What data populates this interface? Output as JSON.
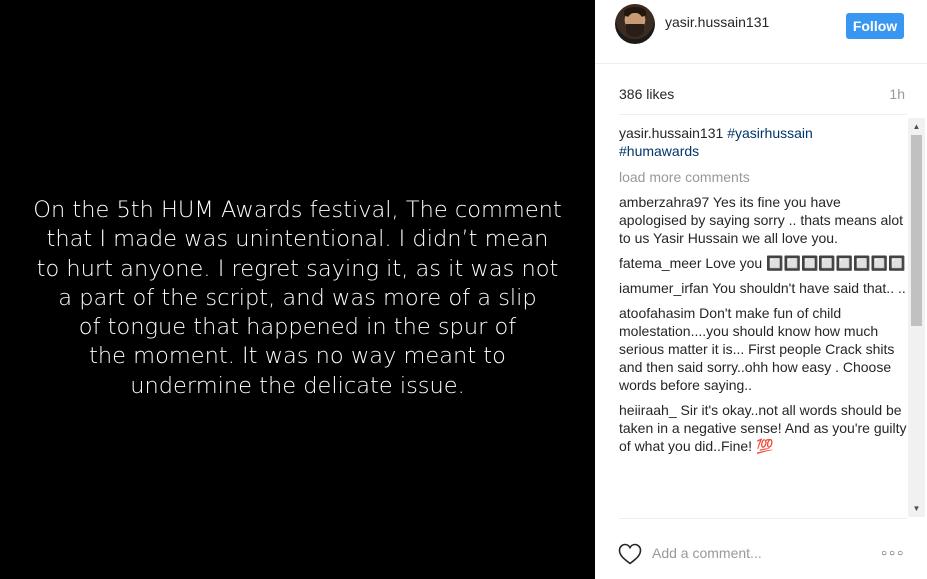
{
  "media": {
    "lines": [
      "On the 5th HUM Awards festival, The comment",
      "that I made was unintentional. I didn’t mean",
      "to hurt anyone. I regret saying it, as it was not",
      "a part of the script, and was more of a slip",
      "of tongue that happened in the spur of",
      "the moment. It was no way meant to",
      "undermine the delicate issue."
    ]
  },
  "header": {
    "username": "yasir.hussain131",
    "follow_label": "Follow",
    "avatar_icon": "user-avatar-icon"
  },
  "stats": {
    "likes": "386 likes",
    "time": "1h"
  },
  "caption": {
    "username": "yasir.hussain131",
    "hashtag1": "#yasirhussain",
    "hashtag2": "#humawards"
  },
  "load_more": "load more comments",
  "comments": [
    {
      "user": "amberzahra97",
      "text": "Yes its fine you have apologised by saying sorry .. thats means alot to us Yasir Hussain we all love you."
    },
    {
      "user": "fatema_meer",
      "text": "Love you 🔲🔲🔲🔲🔲🔲🔲🔲"
    },
    {
      "user": "iamumer_irfan",
      "text": "You shouldn't have said that.. .."
    },
    {
      "user": "atoofahasim",
      "text": "Don't make fun of child molestation....you should know how much serious matter it is... First people Crack shits and then said sorry..ohh how easy . Choose words before saying.."
    },
    {
      "user": "heiiraah_",
      "text": "Sir it's okay..not all words should be taken in a negative sense! And as you're guilty of what you did..Fine! 💯"
    }
  ],
  "footer": {
    "add_comment_placeholder": "Add a comment...",
    "more_label": "○○○",
    "heart_icon": "heart-icon"
  },
  "colors": {
    "follow_button": "#3897f0",
    "hashtag": "#003569",
    "muted": "#999999"
  }
}
